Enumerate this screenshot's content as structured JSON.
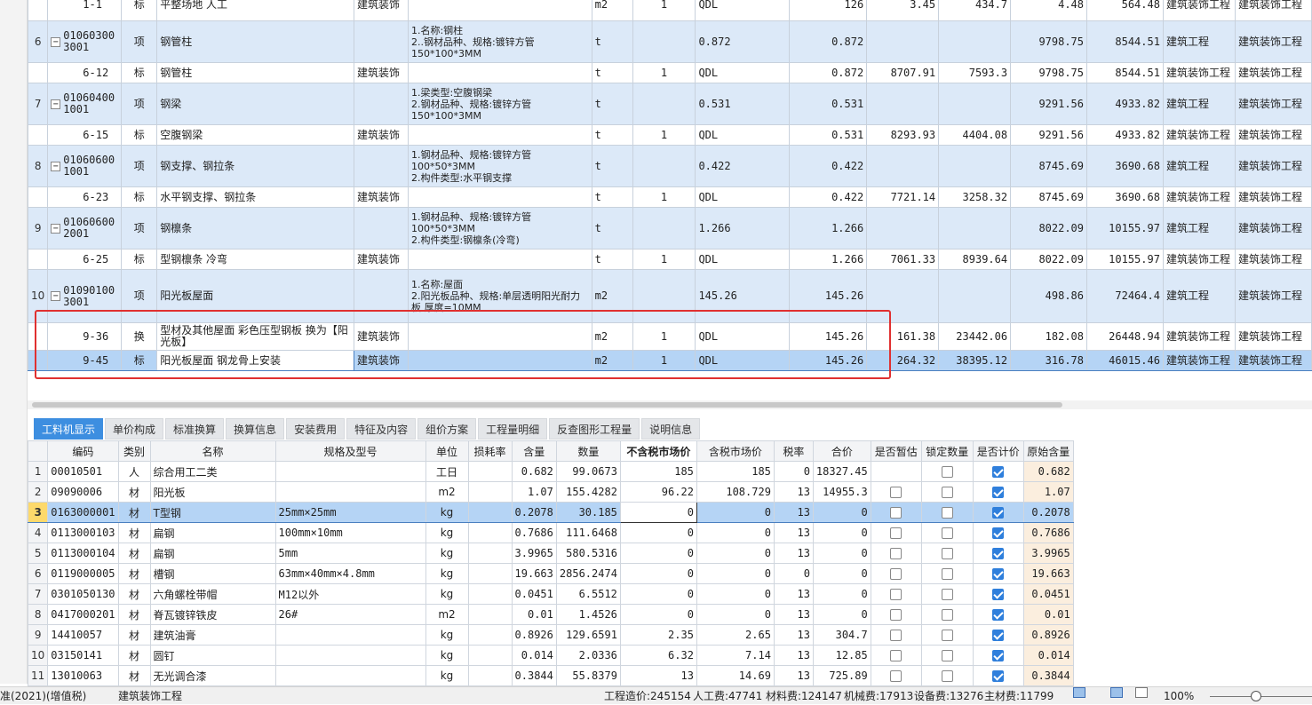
{
  "top_rows": [
    {
      "idx": "",
      "code": "1-1",
      "type": "标",
      "name": "平整场地 人工",
      "major": "建筑装饰",
      "desc": "",
      "unit": "m2",
      "qty_coef": "1",
      "expr": "QDL",
      "qty": "126",
      "p1": "3.45",
      "p2": "434.7",
      "p3": "4.48",
      "p4": "564.48",
      "s1": "建筑装饰工程",
      "s2": "建筑装饰工程",
      "kind": "b"
    },
    {
      "idx": "6",
      "code": "01060300 3001",
      "type": "项",
      "name": "钢管柱",
      "major": "",
      "desc": "1.名称:钢柱\n2..钢材品种、规格:镀锌方管\n150*100*3MM",
      "unit": "t",
      "qty_coef": "",
      "expr": "0.872",
      "qty": "0.872",
      "p1": "",
      "p2": "",
      "p3": "9798.75",
      "p4": "8544.51",
      "s1": "建筑工程",
      "s2": "建筑装饰工程",
      "kind": "q"
    },
    {
      "idx": "",
      "code": "6-12",
      "type": "标",
      "name": "钢管柱",
      "major": "建筑装饰",
      "desc": "",
      "unit": "t",
      "qty_coef": "1",
      "expr": "QDL",
      "qty": "0.872",
      "p1": "8707.91",
      "p2": "7593.3",
      "p3": "9798.75",
      "p4": "8544.51",
      "s1": "建筑装饰工程",
      "s2": "建筑装饰工程",
      "kind": "b"
    },
    {
      "idx": "7",
      "code": "01060400 1001",
      "type": "项",
      "name": "钢梁",
      "major": "",
      "desc": "1.梁类型:空腹钢梁\n2.钢材品种、规格:镀锌方管\n150*100*3MM",
      "unit": "t",
      "qty_coef": "",
      "expr": "0.531",
      "qty": "0.531",
      "p1": "",
      "p2": "",
      "p3": "9291.56",
      "p4": "4933.82",
      "s1": "建筑工程",
      "s2": "建筑装饰工程",
      "kind": "q"
    },
    {
      "idx": "",
      "code": "6-15",
      "type": "标",
      "name": "空腹钢梁",
      "major": "建筑装饰",
      "desc": "",
      "unit": "t",
      "qty_coef": "1",
      "expr": "QDL",
      "qty": "0.531",
      "p1": "8293.93",
      "p2": "4404.08",
      "p3": "9291.56",
      "p4": "4933.82",
      "s1": "建筑装饰工程",
      "s2": "建筑装饰工程",
      "kind": "b"
    },
    {
      "idx": "8",
      "code": "01060600 1001",
      "type": "项",
      "name": "钢支撑、钢拉条",
      "major": "",
      "desc": "1.钢材品种、规格:镀锌方管\n100*50*3MM\n2.构件类型:水平钢支撑",
      "unit": "t",
      "qty_coef": "",
      "expr": "0.422",
      "qty": "0.422",
      "p1": "",
      "p2": "",
      "p3": "8745.69",
      "p4": "3690.68",
      "s1": "建筑工程",
      "s2": "建筑装饰工程",
      "kind": "q"
    },
    {
      "idx": "",
      "code": "6-23",
      "type": "标",
      "name": "水平钢支撑、钢拉条",
      "major": "建筑装饰",
      "desc": "",
      "unit": "t",
      "qty_coef": "1",
      "expr": "QDL",
      "qty": "0.422",
      "p1": "7721.14",
      "p2": "3258.32",
      "p3": "8745.69",
      "p4": "3690.68",
      "s1": "建筑装饰工程",
      "s2": "建筑装饰工程",
      "kind": "b"
    },
    {
      "idx": "9",
      "code": "01060600 2001",
      "type": "项",
      "name": "钢檩条",
      "major": "",
      "desc": "1.钢材品种、规格:镀锌方管\n100*50*3MM\n2.构件类型:钢檩条(冷弯)",
      "unit": "t",
      "qty_coef": "",
      "expr": "1.266",
      "qty": "1.266",
      "p1": "",
      "p2": "",
      "p3": "8022.09",
      "p4": "10155.97",
      "s1": "建筑工程",
      "s2": "建筑装饰工程",
      "kind": "q"
    },
    {
      "idx": "",
      "code": "6-25",
      "type": "标",
      "name": "型钢檩条 冷弯",
      "major": "建筑装饰",
      "desc": "",
      "unit": "t",
      "qty_coef": "1",
      "expr": "QDL",
      "qty": "1.266",
      "p1": "7061.33",
      "p2": "8939.64",
      "p3": "8022.09",
      "p4": "10155.97",
      "s1": "建筑装饰工程",
      "s2": "建筑装饰工程",
      "kind": "b"
    },
    {
      "idx": "10",
      "code": "01090100 3001",
      "type": "项",
      "name": "阳光板屋面",
      "major": "",
      "desc": "1.名称:屋面\n2.阳光板品种、规格:单层透明阳光耐力板 厚度=10MM",
      "unit": "m2",
      "qty_coef": "",
      "expr": "145.26",
      "qty": "145.26",
      "p1": "",
      "p2": "",
      "p3": "498.86",
      "p4": "72464.4",
      "s1": "建筑工程",
      "s2": "建筑装饰工程",
      "kind": "q"
    },
    {
      "idx": "",
      "code": "9-36",
      "type": "换",
      "name": "型材及其他屋面 彩色压型钢板  换为【阳光板】",
      "major": "建筑装饰",
      "desc": "",
      "unit": "m2",
      "qty_coef": "1",
      "expr": "QDL",
      "qty": "145.26",
      "p1": "161.38",
      "p2": "23442.06",
      "p3": "182.08",
      "p4": "26448.94",
      "s1": "建筑装饰工程",
      "s2": "建筑装饰工程",
      "kind": "b"
    },
    {
      "idx": "",
      "code": "9-45",
      "type": "标",
      "name": "阳光板屋面 钢龙骨上安装",
      "major": "建筑装饰",
      "desc": "",
      "unit": "m2",
      "qty_coef": "1",
      "expr": "QDL",
      "qty": "145.26",
      "p1": "264.32",
      "p2": "38395.12",
      "p3": "316.78",
      "p4": "46015.46",
      "s1": "建筑装饰工程",
      "s2": "建筑装饰工程",
      "kind": "sel"
    }
  ],
  "tabs": [
    "工料机显示",
    "单价构成",
    "标准换算",
    "换算信息",
    "安装费用",
    "特征及内容",
    "组价方案",
    "工程量明细",
    "反查图形工程量",
    "说明信息"
  ],
  "bottom_headers": [
    "编码",
    "类别",
    "名称",
    "规格及型号",
    "单位",
    "损耗率",
    "含量",
    "数量",
    "不含税市场价",
    "含税市场价",
    "税率",
    "合价",
    "是否暂估",
    "锁定数量",
    "是否计价",
    "原始含量"
  ],
  "bottom_rows": [
    {
      "n": "1",
      "code": "00010501",
      "cat": "人",
      "name": "综合用工二类",
      "spec": "",
      "unit": "工日",
      "loss": "",
      "content": "0.682",
      "amount": "99.0673",
      "price": "185",
      "tax_price": "185",
      "rate": "0",
      "total": "18327.45",
      "est": null,
      "lock": false,
      "priced": true,
      "orig": "0.682"
    },
    {
      "n": "2",
      "code": "09090006",
      "cat": "材",
      "name": "阳光板",
      "spec": "",
      "unit": "m2",
      "loss": "",
      "content": "1.07",
      "amount": "155.4282",
      "price": "96.22",
      "tax_price": "108.729",
      "rate": "13",
      "total": "14955.3",
      "est": false,
      "lock": false,
      "priced": true,
      "orig": "1.07"
    },
    {
      "n": "3",
      "code": "0163000001",
      "cat": "材",
      "name": "T型钢",
      "spec": "25mm×25mm",
      "unit": "kg",
      "loss": "",
      "content": "0.2078",
      "amount": "30.185",
      "price": "0",
      "tax_price": "0",
      "rate": "13",
      "total": "0",
      "est": false,
      "lock": false,
      "priced": true,
      "orig": "0.2078",
      "sel": true
    },
    {
      "n": "4",
      "code": "0113000103",
      "cat": "材",
      "name": "扁钢",
      "spec": "100mm×10mm",
      "unit": "kg",
      "loss": "",
      "content": "0.7686",
      "amount": "111.6468",
      "price": "0",
      "tax_price": "0",
      "rate": "13",
      "total": "0",
      "est": false,
      "lock": false,
      "priced": true,
      "orig": "0.7686"
    },
    {
      "n": "5",
      "code": "0113000104",
      "cat": "材",
      "name": "扁钢",
      "spec": "5mm",
      "unit": "kg",
      "loss": "",
      "content": "3.9965",
      "amount": "580.5316",
      "price": "0",
      "tax_price": "0",
      "rate": "13",
      "total": "0",
      "est": false,
      "lock": false,
      "priced": true,
      "orig": "3.9965"
    },
    {
      "n": "6",
      "code": "0119000005",
      "cat": "材",
      "name": "槽钢",
      "spec": "63mm×40mm×4.8mm",
      "unit": "kg",
      "loss": "",
      "content": "19.663",
      "amount": "2856.2474",
      "price": "0",
      "tax_price": "0",
      "rate": "0",
      "total": "0",
      "est": false,
      "lock": false,
      "priced": true,
      "orig": "19.663"
    },
    {
      "n": "7",
      "code": "0301050130",
      "cat": "材",
      "name": "六角螺栓带帽",
      "spec": "M12以外",
      "unit": "kg",
      "loss": "",
      "content": "0.0451",
      "amount": "6.5512",
      "price": "0",
      "tax_price": "0",
      "rate": "13",
      "total": "0",
      "est": false,
      "lock": false,
      "priced": true,
      "orig": "0.0451"
    },
    {
      "n": "8",
      "code": "0417000201",
      "cat": "材",
      "name": "脊瓦镀锌铁皮",
      "spec": "26#",
      "unit": "m2",
      "loss": "",
      "content": "0.01",
      "amount": "1.4526",
      "price": "0",
      "tax_price": "0",
      "rate": "13",
      "total": "0",
      "est": false,
      "lock": false,
      "priced": true,
      "orig": "0.01"
    },
    {
      "n": "9",
      "code": "14410057",
      "cat": "材",
      "name": "建筑油膏",
      "spec": "",
      "unit": "kg",
      "loss": "",
      "content": "0.8926",
      "amount": "129.6591",
      "price": "2.35",
      "tax_price": "2.65",
      "rate": "13",
      "total": "304.7",
      "est": false,
      "lock": false,
      "priced": true,
      "orig": "0.8926"
    },
    {
      "n": "10",
      "code": "03150141",
      "cat": "材",
      "name": "圆钉",
      "spec": "",
      "unit": "kg",
      "loss": "",
      "content": "0.014",
      "amount": "2.0336",
      "price": "6.32",
      "tax_price": "7.14",
      "rate": "13",
      "total": "12.85",
      "est": false,
      "lock": false,
      "priced": true,
      "orig": "0.014"
    },
    {
      "n": "11",
      "code": "13010063",
      "cat": "材",
      "name": "无光调合漆",
      "spec": "",
      "unit": "kg",
      "loss": "",
      "content": "0.3844",
      "amount": "55.8379",
      "price": "13",
      "tax_price": "14.69",
      "rate": "13",
      "total": "725.89",
      "est": false,
      "lock": false,
      "priced": true,
      "orig": "0.3844"
    }
  ],
  "status": {
    "left": "准(2021)(增值税)",
    "project": "建筑装饰工程",
    "cost": "工程造价:245154",
    "labor": "人工费:47741",
    "material": "材料费:124147",
    "machine": "机械费:17913",
    "equipment": "设备费:13276",
    "main_material": "主材费:11799",
    "zoom": "100%"
  },
  "colors": {
    "accent": "#3d8ee0",
    "highlight_box": "#e03030",
    "qd_row": "#dce9f8",
    "selected_row": "#b5d4f5"
  }
}
